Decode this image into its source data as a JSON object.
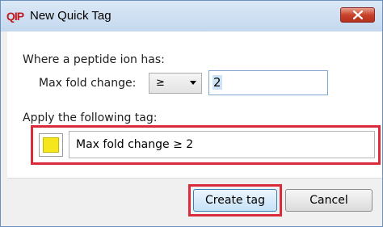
{
  "window": {
    "icon_text": "QIP",
    "title": "New Quick Tag"
  },
  "condition": {
    "heading": "Where a peptide ion has:",
    "field_label": "Max fold change:",
    "operator_selected": "≥",
    "value": "2"
  },
  "tag": {
    "heading": "Apply the following tag:",
    "color": "#f5e61e",
    "name": "Max fold change ≥ 2"
  },
  "buttons": {
    "create_label": "Create tag",
    "cancel_label": "Cancel"
  },
  "highlight_color": "#d92b3a"
}
